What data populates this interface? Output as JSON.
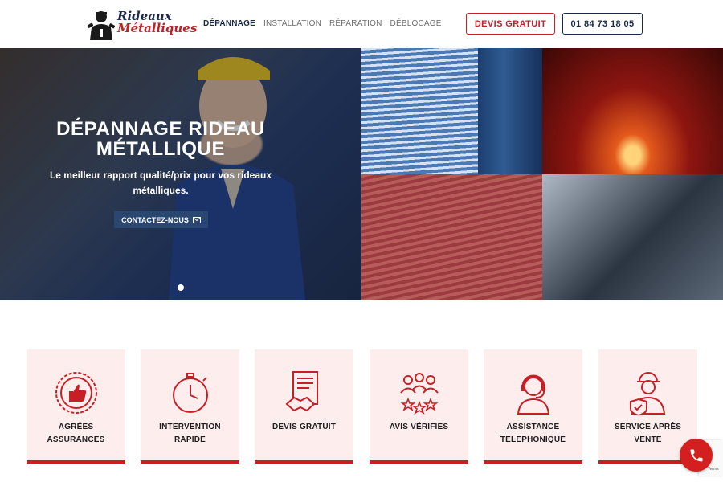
{
  "brand": {
    "name_line1": "Rideaux",
    "name_line2": "Métalliques"
  },
  "nav": {
    "items": [
      {
        "label": "DÉPANNAGE",
        "active": true
      },
      {
        "label": "INSTALLATION",
        "active": false
      },
      {
        "label": "RÉPARATION",
        "active": false
      },
      {
        "label": "DÉBLOCAGE",
        "active": false
      }
    ]
  },
  "header": {
    "devis_label": "DEVIS GRATUIT",
    "phone_label": "01 84 73 18 05"
  },
  "hero": {
    "title_line1": "DÉPANNAGE RIDEAU",
    "title_line2": "MÉTALLIQUE",
    "subtitle_line1": "Le meilleur rapport qualité/prix pour vos rideaux",
    "subtitle_line2": "métalliques.",
    "cta_label": "CONTACTEZ-NOUS"
  },
  "features": [
    {
      "line1": "AGRÉES",
      "line2": "ASSURANCES",
      "icon": "thumbs-up-badge-icon"
    },
    {
      "line1": "INTERVENTION",
      "line2": "RAPIDE",
      "icon": "stopwatch-icon"
    },
    {
      "line1": "DEVIS GRATUIT",
      "line2": "",
      "icon": "document-handshake-icon"
    },
    {
      "line1": "AVIS VÉRIFIES",
      "line2": "",
      "icon": "people-stars-icon"
    },
    {
      "line1": "ASSISTANCE",
      "line2": "TELEPHONIQUE",
      "icon": "headset-agent-icon"
    },
    {
      "line1": "SERVICE APRÈS",
      "line2": "VENTE",
      "icon": "worker-shield-icon"
    }
  ],
  "recaptcha": {
    "text": "Terms"
  },
  "colors": {
    "accent_red": "#c71f26",
    "navy": "#1c2a4a",
    "card_bg": "#fdeeed"
  }
}
